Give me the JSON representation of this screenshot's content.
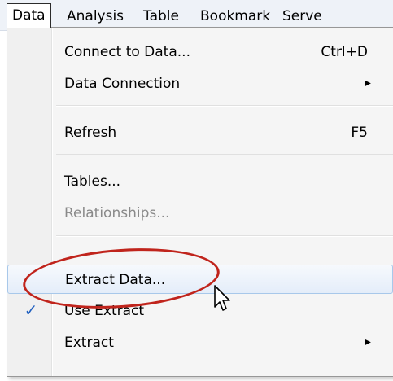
{
  "menubar": {
    "items": [
      {
        "label": "Data"
      },
      {
        "label": "Analysis"
      },
      {
        "label": "Table"
      },
      {
        "label": "Bookmark"
      },
      {
        "label": "Serve"
      }
    ]
  },
  "dropdown": {
    "items": [
      {
        "label": "Connect to Data...",
        "shortcut": "Ctrl+D"
      },
      {
        "label": "Data Connection",
        "submenu": true
      },
      {
        "label": "Refresh",
        "shortcut": "F5"
      },
      {
        "label": "Tables..."
      },
      {
        "label": "Relationships...",
        "disabled": true
      },
      {
        "label": "Extract Data...",
        "highlighted": true
      },
      {
        "label": "Use Extract",
        "checked": true
      },
      {
        "label": "Extract",
        "submenu": true
      }
    ]
  },
  "colors": {
    "annotation": "#c0241c",
    "check": "#1f5fbf",
    "highlight_border": "#a8c8ea"
  },
  "icons": {
    "check": "checkmark-icon",
    "submenu": "submenu-arrow-icon",
    "cursor": "mouse-pointer-icon"
  }
}
